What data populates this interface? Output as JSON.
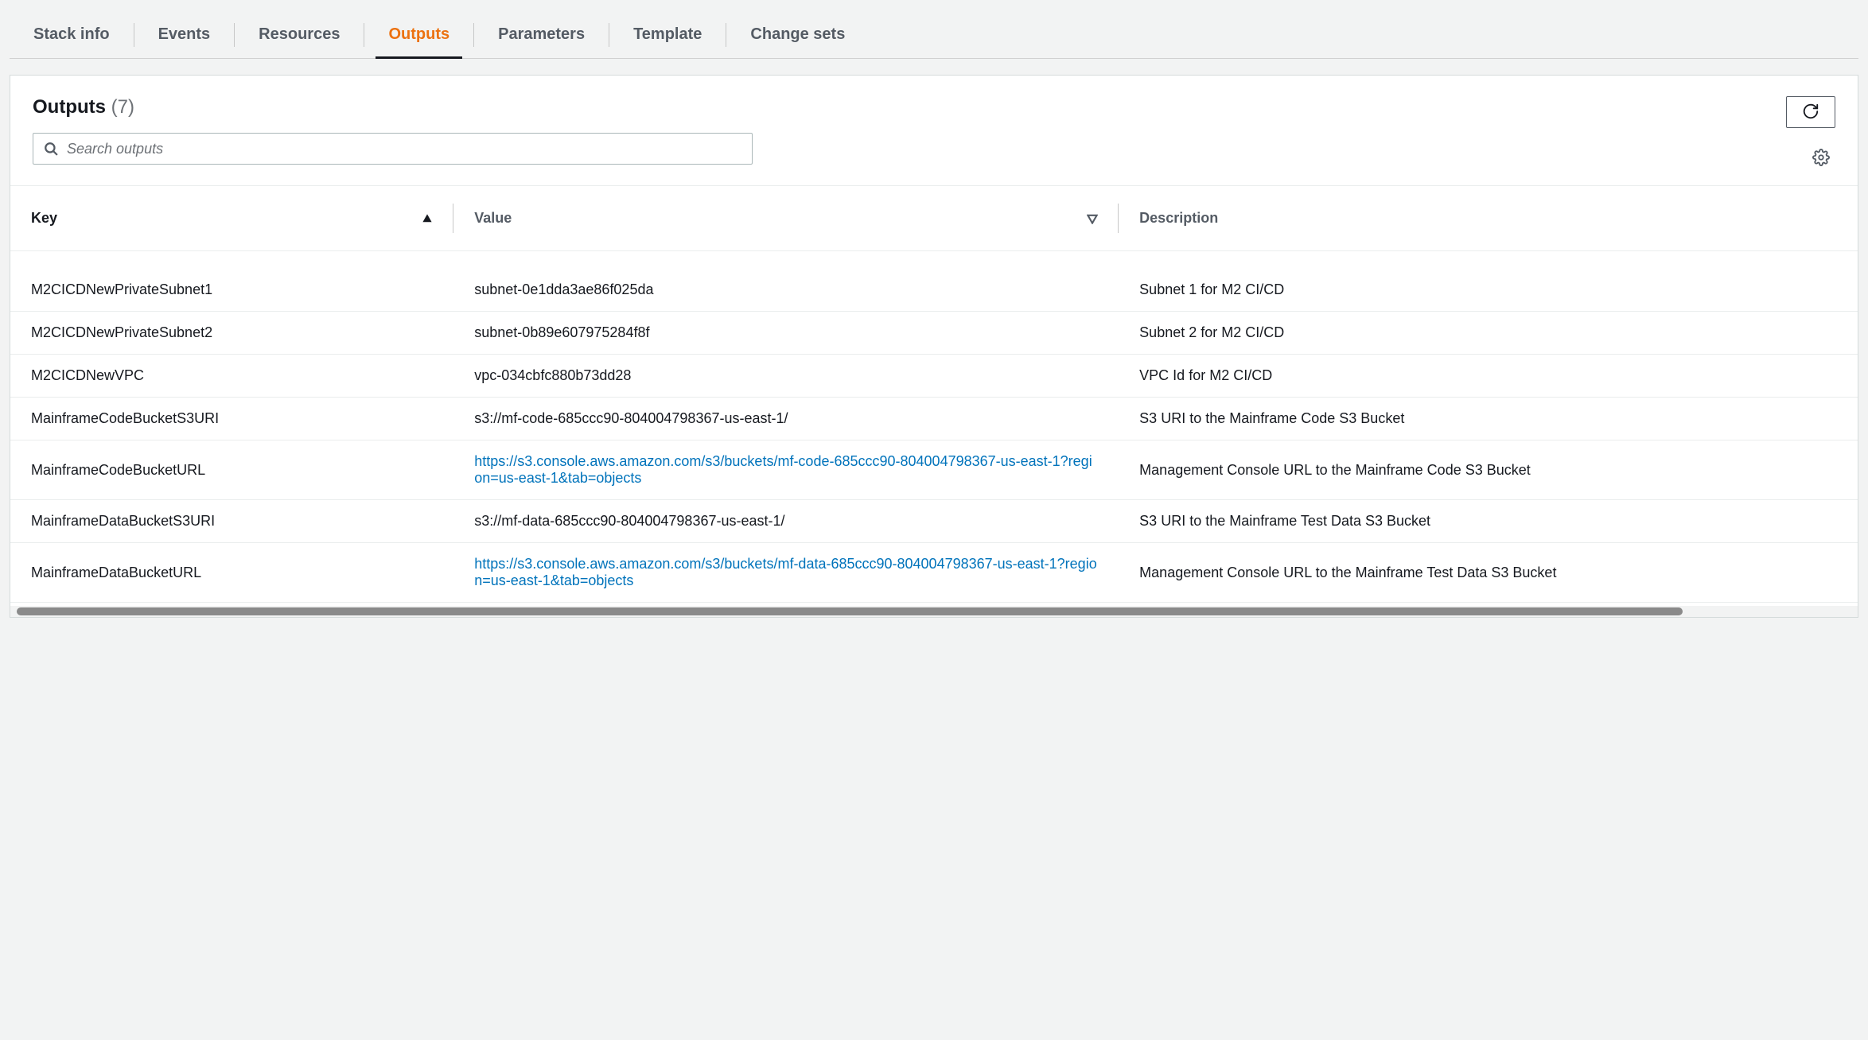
{
  "tabs": [
    {
      "id": "stack-info",
      "label": "Stack info"
    },
    {
      "id": "events",
      "label": "Events"
    },
    {
      "id": "resources",
      "label": "Resources"
    },
    {
      "id": "outputs",
      "label": "Outputs",
      "active": true
    },
    {
      "id": "parameters",
      "label": "Parameters"
    },
    {
      "id": "template",
      "label": "Template"
    },
    {
      "id": "change-sets",
      "label": "Change sets"
    }
  ],
  "panel": {
    "title": "Outputs",
    "count_label": "(7)",
    "search_placeholder": "Search outputs"
  },
  "table": {
    "headers": {
      "key": "Key",
      "value": "Value",
      "description": "Description"
    },
    "sort": {
      "column": "key",
      "direction": "asc"
    },
    "rows": [
      {
        "key": "M2CICDNewPrivateSubnet1",
        "value": "subnet-0e1dda3ae86f025da",
        "link": false,
        "description": "Subnet 1 for M2 CI/CD"
      },
      {
        "key": "M2CICDNewPrivateSubnet2",
        "value": "subnet-0b89e607975284f8f",
        "link": false,
        "description": "Subnet 2 for M2 CI/CD"
      },
      {
        "key": "M2CICDNewVPC",
        "value": "vpc-034cbfc880b73dd28",
        "link": false,
        "description": "VPC Id for M2 CI/CD"
      },
      {
        "key": "MainframeCodeBucketS3URI",
        "value": "s3://mf-code-685ccc90-804004798367-us-east-1/",
        "link": false,
        "description": "S3 URI to the Mainframe Code S3 Bucket"
      },
      {
        "key": "MainframeCodeBucketURL",
        "value": "https://s3.console.aws.amazon.com/s3/buckets/mf-code-685ccc90-804004798367-us-east-1?region=us-east-1&tab=objects",
        "link": true,
        "description": "Management Console URL to the Mainframe Code S3 Bucket"
      },
      {
        "key": "MainframeDataBucketS3URI",
        "value": "s3://mf-data-685ccc90-804004798367-us-east-1/",
        "link": false,
        "description": "S3 URI to the Mainframe Test Data S3 Bucket"
      },
      {
        "key": "MainframeDataBucketURL",
        "value": "https://s3.console.aws.amazon.com/s3/buckets/mf-data-685ccc90-804004798367-us-east-1?region=us-east-1&tab=objects",
        "link": true,
        "description": "Management Console URL to the Mainframe Test Data S3 Bucket"
      }
    ]
  }
}
